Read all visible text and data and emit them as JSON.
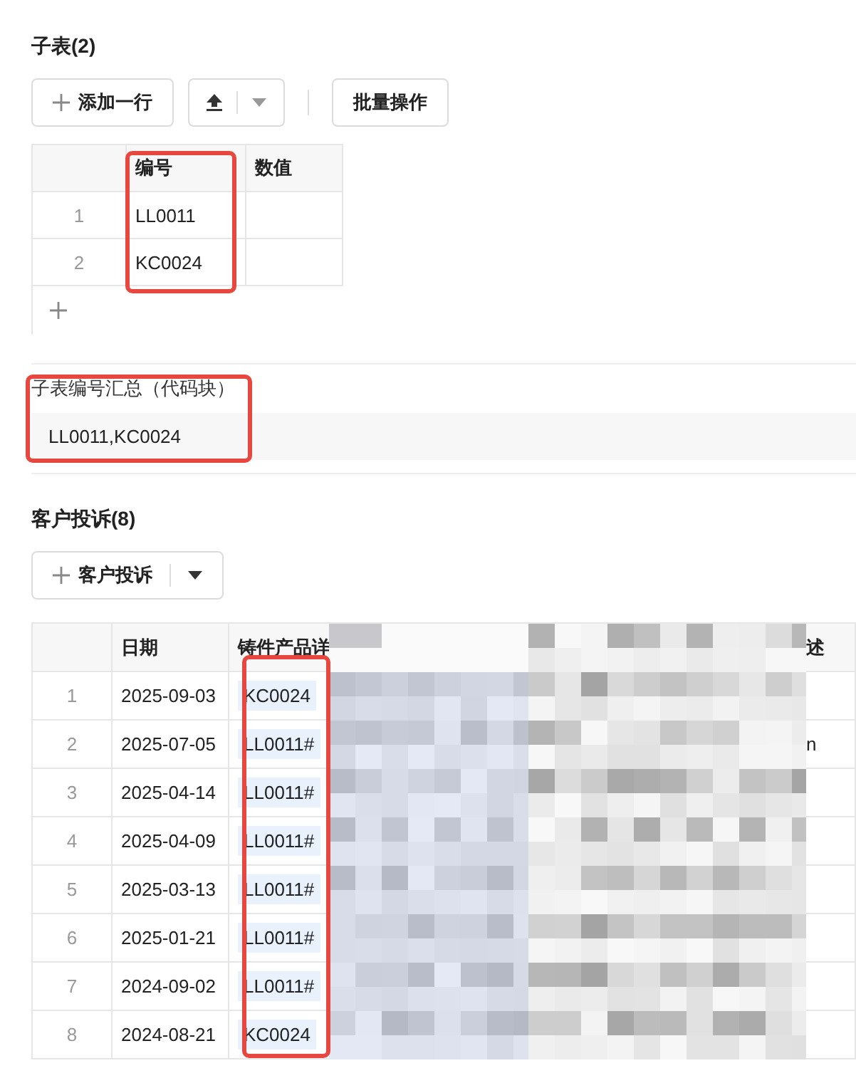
{
  "subtable": {
    "title": "子表(2)",
    "add_button": "添加一行",
    "batch_button": "批量操作",
    "columns": [
      "编号",
      "数值"
    ],
    "rows": [
      {
        "index": "1",
        "code": "LL0011"
      },
      {
        "index": "2",
        "code": "KC0024"
      }
    ]
  },
  "summary": {
    "label": "子表编号汇总（代码块）",
    "code": "LL0011,KC0024"
  },
  "complaints": {
    "title": "客户投诉(8)",
    "button": "客户投诉",
    "columns": [
      "日期",
      "铸件产品详",
      "述"
    ],
    "rows": [
      {
        "index": "1",
        "date": "2025-09-03",
        "product": "KC0024"
      },
      {
        "index": "2",
        "date": "2025-07-05",
        "product": "LL0011#",
        "column_4": "n"
      },
      {
        "index": "3",
        "date": "2025-04-14",
        "product": "LL0011#"
      },
      {
        "index": "4",
        "date": "2025-04-09",
        "product": "LL0011#"
      },
      {
        "index": "5",
        "date": "2025-03-13",
        "product": "LL0011#"
      },
      {
        "index": "6",
        "date": "2025-01-21",
        "product": "LL0011#"
      },
      {
        "index": "7",
        "date": "2024-09-02",
        "product": "LL0011#"
      },
      {
        "index": "8",
        "date": "2024-08-21",
        "product": "KC0024"
      }
    ]
  }
}
